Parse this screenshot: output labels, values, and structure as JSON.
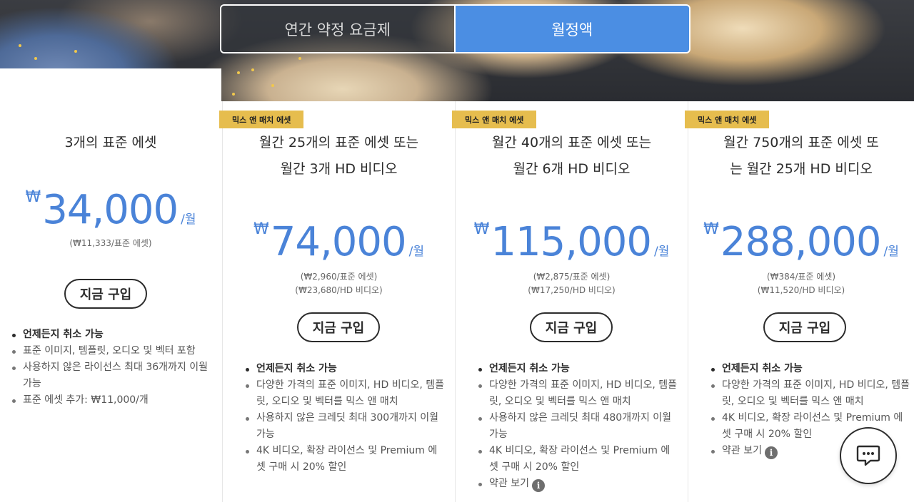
{
  "billing_toggle": {
    "annual_label": "연간 약정 요금제",
    "monthly_label": "월정액",
    "selected": "monthly"
  },
  "colors": {
    "accent": "#4a83d8",
    "toggle_active": "#4b8ee3",
    "badge": "#e6bd4e"
  },
  "plans": [
    {
      "badge": "",
      "title": "3개의 표준 에셋",
      "currency": "₩",
      "amount": "34,000",
      "period": "/월",
      "unit_prices": [
        "(₩11,333/표준 에셋)"
      ],
      "buy_label": "지금 구입",
      "features": [
        "언제든지 취소 가능",
        "표준 이미지, 템플릿, 오디오 및 벡터 포함",
        "사용하지 않은 라이선스 최대 36개까지 이월 가능",
        "표준 에셋 추가: ₩11,000/개"
      ]
    },
    {
      "badge": "믹스 앤 매치 에셋",
      "title": "월간 25개의 표준 에셋 또는 월간 3개 HD 비디오",
      "currency": "₩",
      "amount": "74,000",
      "period": "/월",
      "unit_prices": [
        "(₩2,960/표준 에셋)",
        "(₩23,680/HD 비디오)"
      ],
      "buy_label": "지금 구입",
      "features": [
        "언제든지 취소 가능",
        "다양한 가격의 표준 이미지, HD 비디오, 템플릿, 오디오 및 벡터를 믹스 앤 매치",
        "사용하지 않은 크레딧 최대 300개까지 이월 가능",
        "4K 비디오, 확장 라이선스 및 Premium 에셋 구매 시 20% 할인"
      ]
    },
    {
      "badge": "믹스 앤 매치 에셋",
      "title": "월간 40개의 표준 에셋 또는 월간 6개 HD 비디오",
      "currency": "₩",
      "amount": "115,000",
      "period": "/월",
      "unit_prices": [
        "(₩2,875/표준 에셋)",
        "(₩17,250/HD 비디오)"
      ],
      "buy_label": "지금 구입",
      "features": [
        "언제든지 취소 가능",
        "다양한 가격의 표준 이미지, HD 비디오, 템플릿, 오디오 및 벡터를 믹스 앤 매치",
        "사용하지 않은 크레딧 최대 480개까지 이월 가능",
        "4K 비디오, 확장 라이선스 및 Premium 에셋 구매 시 20% 할인"
      ],
      "terms_label": "약관 보기"
    },
    {
      "badge": "믹스 앤 매치 에셋",
      "title": "월간 750개의 표준 에셋 또는 월간 25개 HD 비디오",
      "currency": "₩",
      "amount": "288,000",
      "period": "/월",
      "unit_prices": [
        "(₩384/표준 에셋)",
        "(₩11,520/HD 비디오)"
      ],
      "buy_label": "지금 구입",
      "features": [
        "언제든지 취소 가능",
        "다양한 가격의 표준 이미지, HD 비디오, 템플릿, 오디오 및 벡터를 믹스 앤 매치",
        "4K 비디오, 확장 라이선스 및 Premium 에셋 구매 시 20% 할인"
      ],
      "terms_label": "약관 보기"
    }
  ],
  "info_icon_glyph": "i",
  "chat_icon": "chat-bubble-icon"
}
